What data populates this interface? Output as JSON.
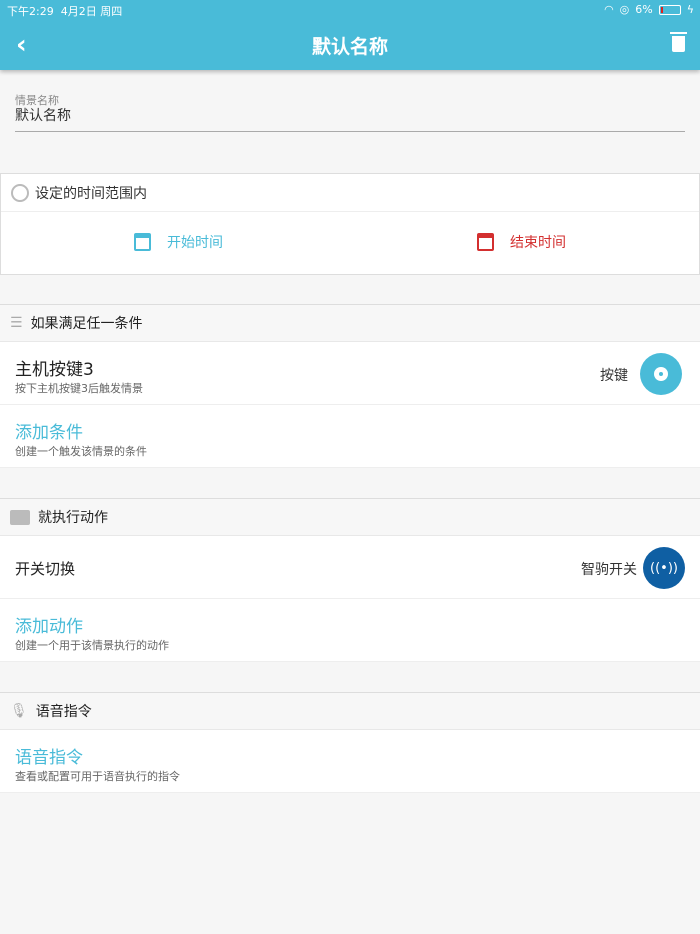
{
  "status_bar": {
    "time": "下午2:29",
    "date": "4月2日 周四",
    "battery": "6%"
  },
  "header": {
    "title": "默认名称"
  },
  "name_field": {
    "label": "情景名称",
    "value": "默认名称"
  },
  "time_range": {
    "title": "设定的时间范围内",
    "start": "开始时间",
    "end": "结束时间"
  },
  "conditions": {
    "title": "如果满足任一条件",
    "items": [
      {
        "title": "主机按键3",
        "subtitle": "按下主机按键3后触发情景",
        "type": "按键"
      }
    ],
    "add_title": "添加条件",
    "add_subtitle": "创建一个触发该情景的条件"
  },
  "actions": {
    "title": "就执行动作",
    "items": [
      {
        "title": "开关切换",
        "type": "智驹开关"
      }
    ],
    "add_title": "添加动作",
    "add_subtitle": "创建一个用于该情景执行的动作"
  },
  "voice": {
    "title": "语音指令",
    "item_title": "语音指令",
    "item_subtitle": "查看或配置可用于语音执行的指令"
  },
  "colors": {
    "primary": "#49bbd8",
    "end": "#d32f2f",
    "switch": "#0f5fa3"
  }
}
